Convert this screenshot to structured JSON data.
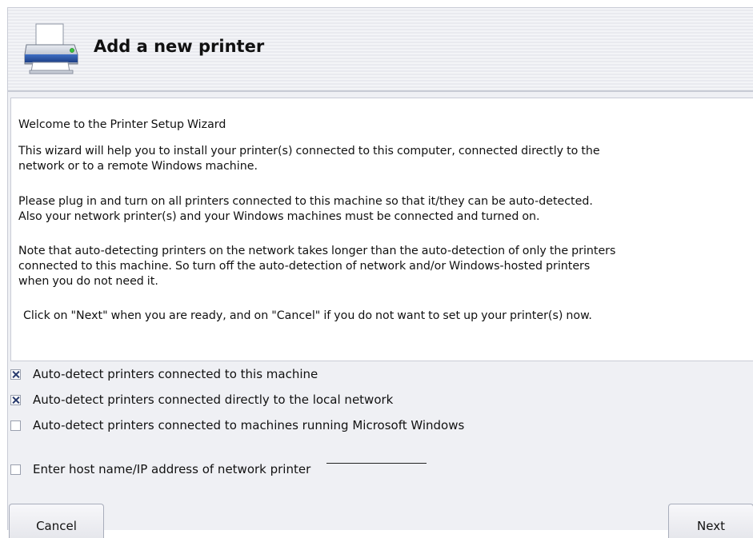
{
  "header": {
    "title": "Add a new printer",
    "icon": "printer-icon"
  },
  "intro": {
    "welcome": "Welcome to the Printer Setup Wizard",
    "para1": "This wizard will help you to install your printer(s) connected to this computer, connected directly to the\nnetwork or to a remote Windows machine.",
    "para2": "Please plug in and turn on all printers connected to this machine so that it/they can be auto-detected.\nAlso your network printer(s) and your Windows machines must be connected and turned on.",
    "para3": "Note that auto-detecting printers on the network takes longer than the auto-detection of only the printers\nconnected to this machine. So turn off the auto-detection of network and/or Windows-hosted printers\nwhen you do not need it.",
    "para4": "Click on \"Next\" when you are ready, and on \"Cancel\" if you do not want to set up your printer(s) now."
  },
  "options": [
    {
      "label": "Auto-detect printers connected to this machine",
      "checked": true
    },
    {
      "label": "Auto-detect printers connected directly to the local network",
      "checked": true
    },
    {
      "label": "Auto-detect printers connected to machines running Microsoft Windows",
      "checked": false
    },
    {
      "label": "Enter host name/IP address of network printer",
      "checked": false
    }
  ],
  "buttons": {
    "cancel": "Cancel",
    "next": "Next"
  },
  "colors": {
    "checkmark": "#2a3c6e",
    "panel_bg": "#ffffff",
    "window_bg": "#eff0f4"
  }
}
